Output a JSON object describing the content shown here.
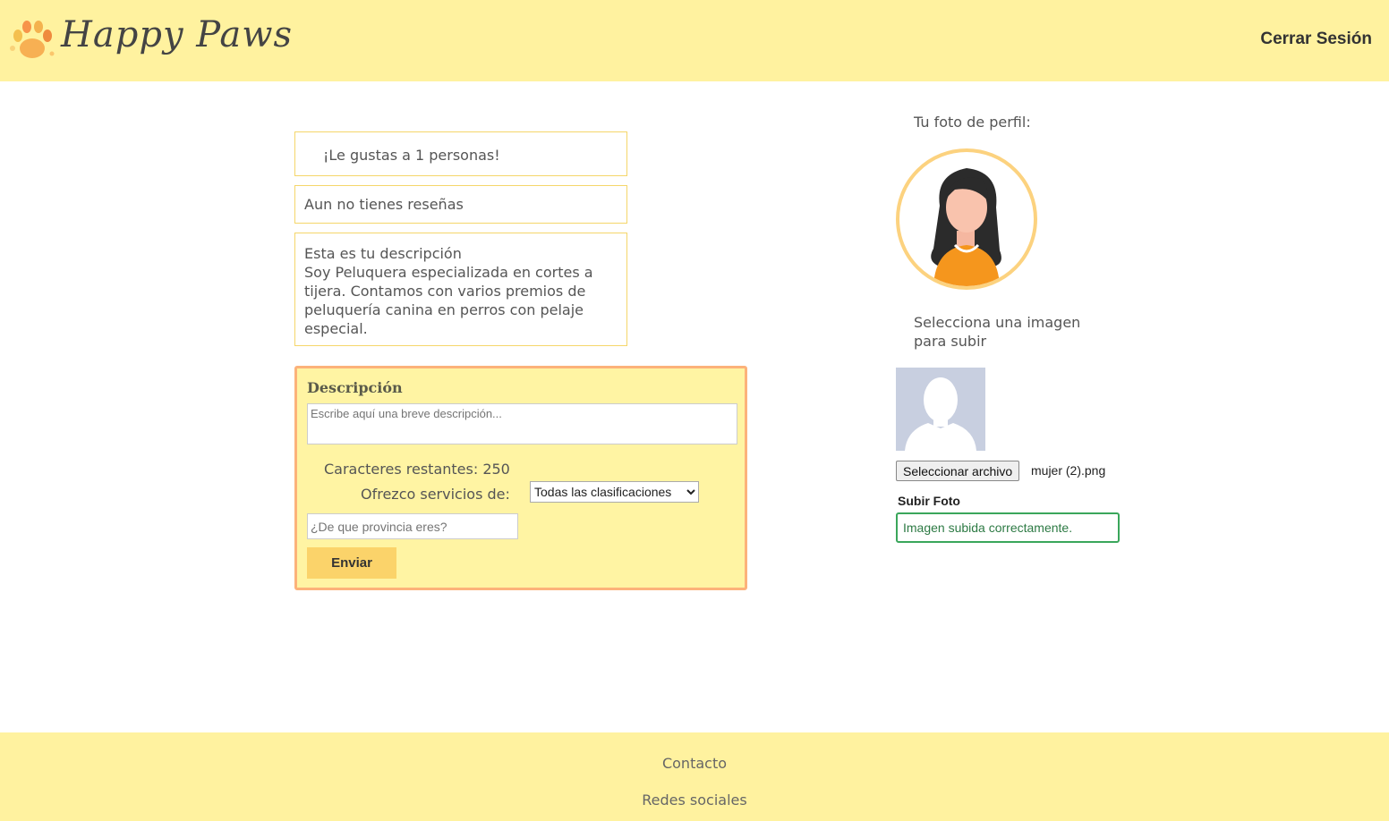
{
  "header": {
    "logo_text": "Happy Paws",
    "logout_label": "Cerrar Sesión"
  },
  "profile": {
    "likes_text": "¡Le gustas a 1 personas!",
    "reviews_text": "Aun no tienes reseñas",
    "description_heading": "Esta es tu descripción",
    "description_text": "Soy Peluquera especializada en cortes a tijera. Contamos con varios premios de peluquería canina en perros con pelaje especial."
  },
  "form": {
    "title": "Descripción",
    "description_placeholder": "Escribe aquí una breve descripción...",
    "chars_remaining": "Caracteres restantes: 250",
    "services_label": "Ofrezco servicios de:",
    "services_selected": "Todas las clasificaciones",
    "province_placeholder": "¿De que provincia eres?",
    "submit_label": "Enviar"
  },
  "photo": {
    "profile_label": "Tu foto de perfil:",
    "select_label": "Selecciona una imagen para subir",
    "file_button_label": "Seleccionar archivo",
    "file_name": "mujer (2).png",
    "upload_label": "Subir Foto",
    "upload_status": "Imagen subida correctamente."
  },
  "footer": {
    "contact_label": "Contacto",
    "social_label": "Redes sociales"
  },
  "colors": {
    "header_bg": "#fff29f",
    "form_border": "#fcb27a",
    "button_bg": "#fbd36a",
    "success_border": "#3aa65b"
  },
  "icons": [
    "paw-logo-icon",
    "woman-avatar-icon",
    "user-silhouette-icon",
    "chevron-down-icon"
  ]
}
